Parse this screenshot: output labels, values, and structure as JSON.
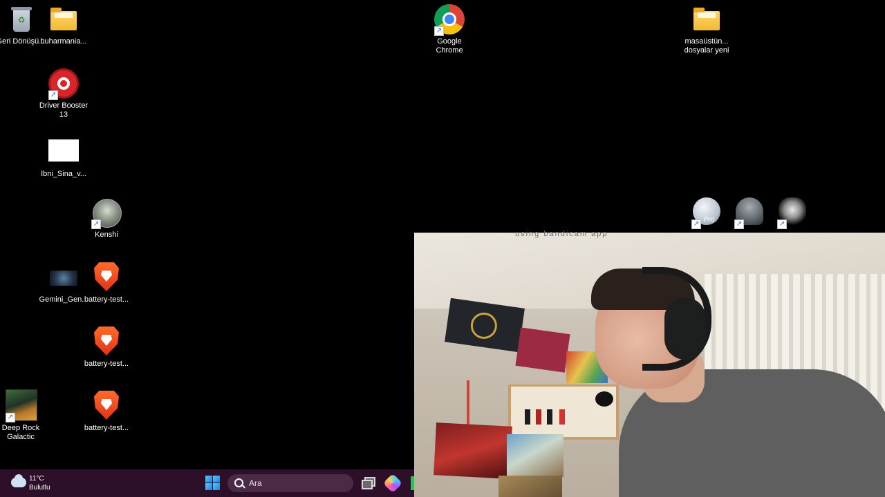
{
  "desktop": {
    "icons": {
      "recycle_bin": "Geri Dönüşü...",
      "buharmania": "buharmania...",
      "chrome": "Google Chrome",
      "masaustu": "masaüstün... dosyalar yeni",
      "driver_booster": "Driver Booster 13",
      "ibni_sina": "İbni_Sina_v...",
      "kenshi": "Kenshi",
      "gemini": "Gemini_Gen...",
      "battery_test_1": "battery-test...",
      "battery_test_2": "battery-test...",
      "battery_test_3": "battery-test...",
      "deep_rock": "Deep Rock Galactic",
      "google_earth_pro_overlay": "Pro"
    }
  },
  "webcam": {
    "watermark": "using bandicam app"
  },
  "taskbar": {
    "weather_temp": "11°C",
    "weather_condition": "Bulutlu",
    "search_placeholder": "Ara"
  },
  "colors": {
    "desktop_bg": "#000000",
    "taskbar_bg": "#2e0f2a",
    "search_bg": "#4a2a46"
  }
}
